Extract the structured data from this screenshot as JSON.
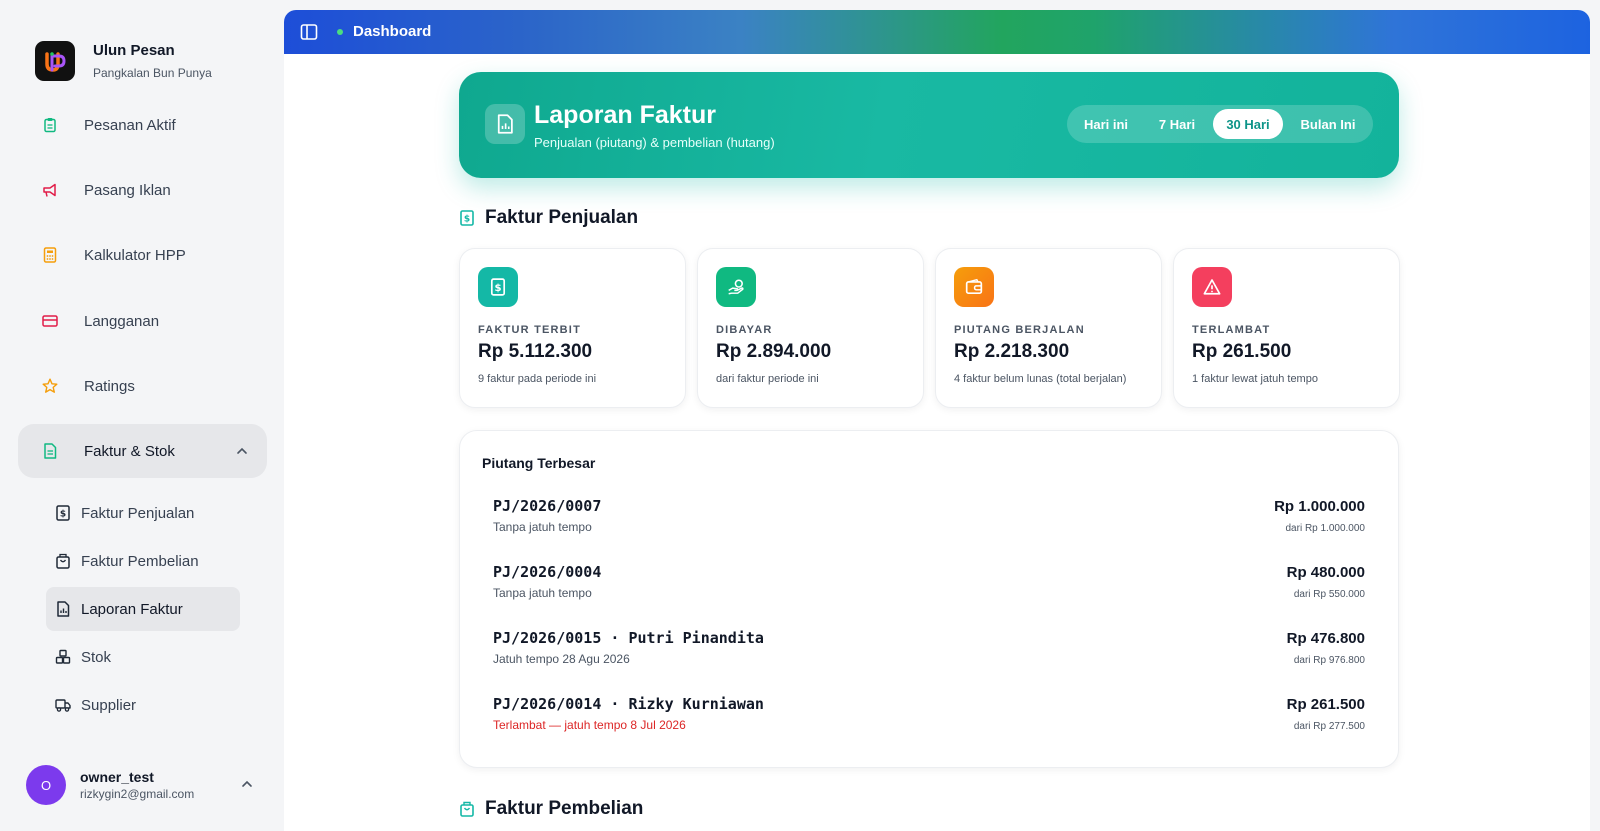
{
  "brand": {
    "name": "Ulun Pesan",
    "subtitle": "Pangkalan Bun Punya"
  },
  "nav": {
    "items": [
      {
        "label": "Pesanan Aktif",
        "icon": "clipboard-icon",
        "color": "#10b981"
      },
      {
        "label": "Pasang Iklan",
        "icon": "megaphone-icon",
        "color": "#e11d48"
      },
      {
        "label": "Kalkulator HPP",
        "icon": "calculator-icon",
        "color": "#f59e0b"
      },
      {
        "label": "Langganan",
        "icon": "credit-card-icon",
        "color": "#e11d48"
      },
      {
        "label": "Ratings",
        "icon": "star-icon",
        "color": "#f59e0b"
      },
      {
        "label": "Faktur & Stok",
        "icon": "document-icon",
        "color": "#10b981"
      }
    ],
    "subitems": [
      {
        "label": "Faktur Penjualan",
        "icon": "invoice-dollar-icon"
      },
      {
        "label": "Faktur Pembelian",
        "icon": "shopping-bag-icon"
      },
      {
        "label": "Laporan Faktur",
        "icon": "report-chart-icon"
      },
      {
        "label": "Stok",
        "icon": "boxes-icon"
      },
      {
        "label": "Supplier",
        "icon": "truck-icon"
      }
    ]
  },
  "user": {
    "initial": "O",
    "name": "owner_test",
    "email": "rizkygin2@gmail.com"
  },
  "topbar": {
    "title": "Dashboard"
  },
  "hero": {
    "title": "Laporan Faktur",
    "subtitle": "Penjualan (piutang) & pembelian (hutang)",
    "ranges": [
      "Hari ini",
      "7 Hari",
      "30 Hari",
      "Bulan Ini"
    ],
    "active_range": "30 Hari"
  },
  "sales": {
    "title": "Faktur Penjualan",
    "stats": [
      {
        "label": "FAKTUR TERBIT",
        "value": "Rp 5.112.300",
        "note": "9 faktur pada periode ini",
        "color": "#14b8a6",
        "icon": "invoice-icon"
      },
      {
        "label": "DIBAYAR",
        "value": "Rp 2.894.000",
        "note": "dari faktur periode ini",
        "color": "#10b981",
        "icon": "hand-coins-icon"
      },
      {
        "label": "PIUTANG BERJALAN",
        "value": "Rp 2.218.300",
        "note": "4 faktur belum lunas (total berjalan)",
        "color": "#f59e0b",
        "icon": "wallet-icon"
      },
      {
        "label": "TERLAMBAT",
        "value": "Rp 261.500",
        "note": "1 faktur lewat jatuh tempo",
        "color": "#f43f5e",
        "icon": "alert-triangle-icon"
      }
    ],
    "top_receivables": {
      "title": "Piutang Terbesar",
      "rows": [
        {
          "id": "PJ/2026/0007",
          "sub": "Tanpa jatuh tempo",
          "amount": "Rp 1.000.000",
          "of": "dari Rp 1.000.000",
          "overdue": false
        },
        {
          "id": "PJ/2026/0004",
          "sub": "Tanpa jatuh tempo",
          "amount": "Rp 480.000",
          "of": "dari Rp 550.000",
          "overdue": false
        },
        {
          "id": "PJ/2026/0015 · Putri Pinandita",
          "sub": "Jatuh tempo 28 Agu 2026",
          "amount": "Rp 476.800",
          "of": "dari Rp 976.800",
          "overdue": false
        },
        {
          "id": "PJ/2026/0014 · Rizky Kurniawan",
          "sub": "Terlambat — jatuh tempo 8 Jul 2026",
          "amount": "Rp 261.500",
          "of": "dari Rp 277.500",
          "overdue": true
        }
      ]
    }
  },
  "purchases": {
    "title": "Faktur Pembelian"
  }
}
